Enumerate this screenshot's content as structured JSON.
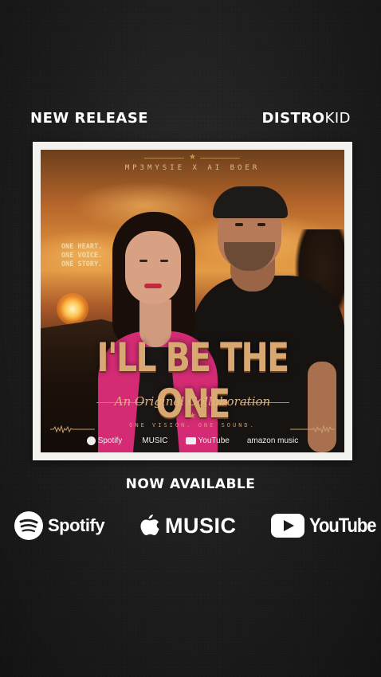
{
  "header": {
    "left_label": "NEW RELEASE",
    "brand_bold": "DISTRO",
    "brand_light": "KID"
  },
  "cover": {
    "artists": "MP3MYSIE X AI BOER",
    "tagline": [
      "ONE HEART.",
      "ONE VOICE.",
      "ONE STORY."
    ],
    "title": "I'LL BE THE ONE",
    "subtitle": "An Original Collaboration",
    "slogan": "ONE VISION. ONE SOUND.",
    "platforms": [
      "Spotify",
      "MUSIC",
      "YouTube",
      "amazon music"
    ]
  },
  "availability": {
    "label": "NOW AVAILABLE",
    "platforms": [
      {
        "name": "Spotify",
        "icon": "spotify-icon"
      },
      {
        "name": "MUSIC",
        "icon": "apple-icon"
      },
      {
        "name": "YouTube",
        "icon": "youtube-play-icon"
      }
    ]
  },
  "colors": {
    "background": "#1c1c1c",
    "title_gold": "#d9a872",
    "frame": "#f4f2ef",
    "jacket_pink": "#d42b74"
  }
}
